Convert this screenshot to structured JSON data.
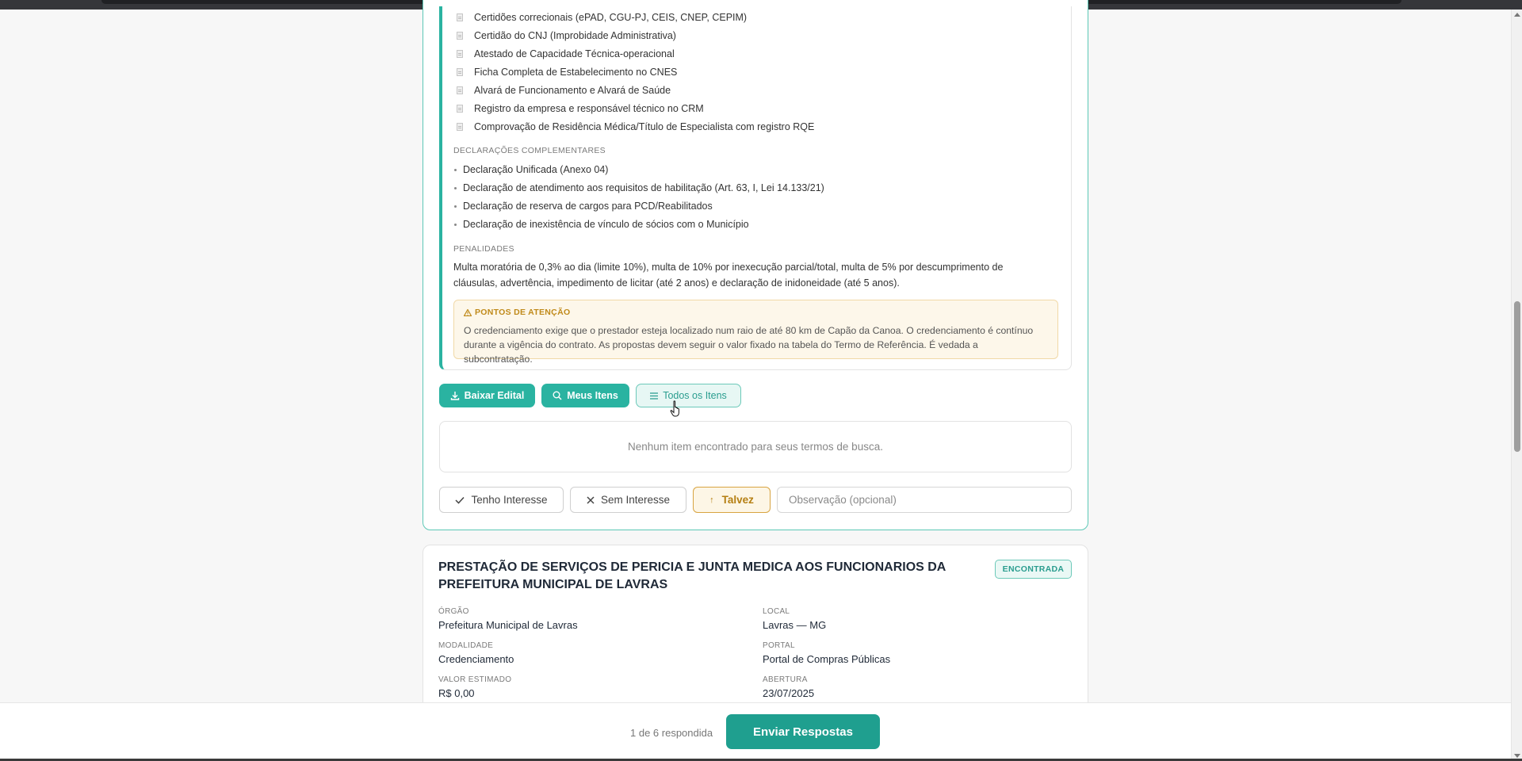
{
  "documents": [
    "Certidões correcionais (ePAD, CGU-PJ, CEIS, CNEP, CEPIM)",
    "Certidão do CNJ (Improbidade Administrativa)",
    "Atestado de Capacidade Técnica-operacional",
    "Ficha Completa de Estabelecimento no CNES",
    "Alvará de Funcionamento e Alvará de Saúde",
    "Registro da empresa e responsável técnico no CRM",
    "Comprovação de Residência Médica/Título de Especialista com registro RQE"
  ],
  "declarations": {
    "title": "DECLARAÇÕES COMPLEMENTARES",
    "items": [
      "Declaração Unificada (Anexo 04)",
      "Declaração de atendimento aos requisitos de habilitação (Art. 63, I, Lei 14.133/21)",
      "Declaração de reserva de cargos para PCD/Reabilitados",
      "Declaração de inexistência de vínculo de sócios com o Município"
    ]
  },
  "penalties": {
    "title": "PENALIDADES",
    "text": "Multa moratória de 0,3% ao dia (limite 10%), multa de 10% por inexecução parcial/total, multa de 5% por descumprimento de cláusulas, advertência, impedimento de licitar (até 2 anos) e declaração de inidoneidade (até 5 anos)."
  },
  "attention": {
    "title": "PONTOS DE ATENÇÃO",
    "text": "O credenciamento exige que o prestador esteja localizado num raio de até 80 km de Capão da Canoa. O credenciamento é contínuo durante a vigência do contrato. As propostas devem seguir o valor fixado na tabela do Termo de Referência. É vedada a subcontratação."
  },
  "actions": {
    "download": "Baixar Edital",
    "my_items": "Meus Itens",
    "all_items": "Todos os Itens"
  },
  "empty_message": "Nenhum item encontrado para seus termos de busca.",
  "interest": {
    "yes": "Tenho Interesse",
    "no": "Sem Interesse",
    "maybe": "Talvez",
    "maybe_icon": "↑",
    "observation_placeholder": "Observação (opcional)"
  },
  "card2": {
    "title": "PRESTAÇÃO DE SERVIÇOS DE PERICIA E JUNTA MEDICA AOS FUNCIONARIOS DA PREFEITURA MUNICIPAL DE LAVRAS",
    "badge": "ENCONTRADA",
    "orgao_label": "ÓRGÃO",
    "orgao": "Prefeitura Municipal de Lavras",
    "local_label": "LOCAL",
    "local": "Lavras — MG",
    "modalidade_label": "MODALIDADE",
    "modalidade": "Credenciamento",
    "portal_label": "PORTAL",
    "portal": "Portal de Compras Públicas",
    "valor_label": "VALOR ESTIMADO",
    "valor": "R$ 0,00",
    "abertura_label": "ABERTURA",
    "abertura": "23/07/2025"
  },
  "footer": {
    "count": "1 de 6 respondida",
    "send": "Enviar Respostas"
  },
  "colors": {
    "accent": "#2ab3a1",
    "warning": "#d8a441",
    "warning_bg": "#fdf7ea"
  }
}
